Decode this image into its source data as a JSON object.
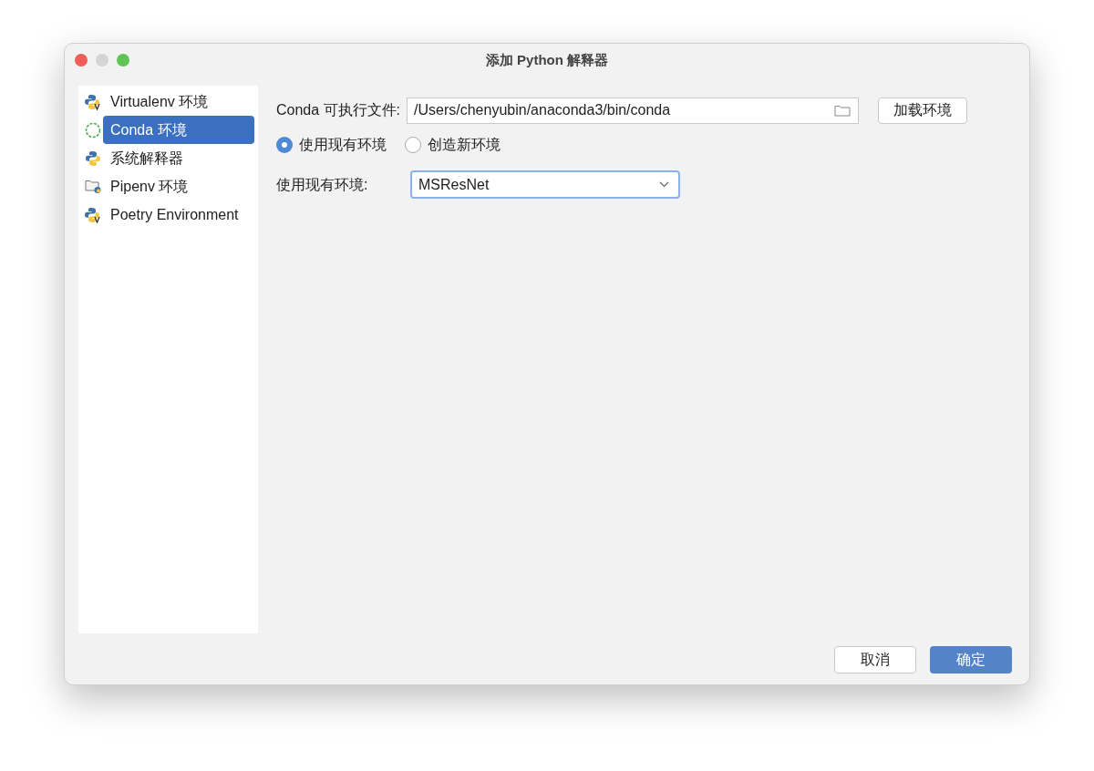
{
  "window": {
    "title": "添加 Python 解释器"
  },
  "sidebar": {
    "items": [
      {
        "label": "Virtualenv 环境",
        "kind": "virtualenv",
        "selected": false
      },
      {
        "label": "Conda 环境",
        "kind": "conda",
        "selected": true
      },
      {
        "label": "系统解释器",
        "kind": "python",
        "selected": false
      },
      {
        "label": "Pipenv 环境",
        "kind": "pipenv",
        "selected": false
      },
      {
        "label": "Poetry Environment",
        "kind": "virtualenv",
        "selected": false
      }
    ]
  },
  "executable": {
    "label": "Conda 可执行文件:",
    "value": "/Users/chenyubin/anaconda3/bin/conda",
    "button": "加载环境"
  },
  "mode": [
    {
      "label": "使用现有环境",
      "selected": true
    },
    {
      "label": "创造新环境",
      "selected": false
    }
  ],
  "environment": {
    "label": "使用现有环境:",
    "value": "MSResNet"
  },
  "buttons": [
    {
      "label": "取消",
      "kind": "secondary"
    },
    {
      "label": "确定",
      "kind": "primary"
    }
  ]
}
